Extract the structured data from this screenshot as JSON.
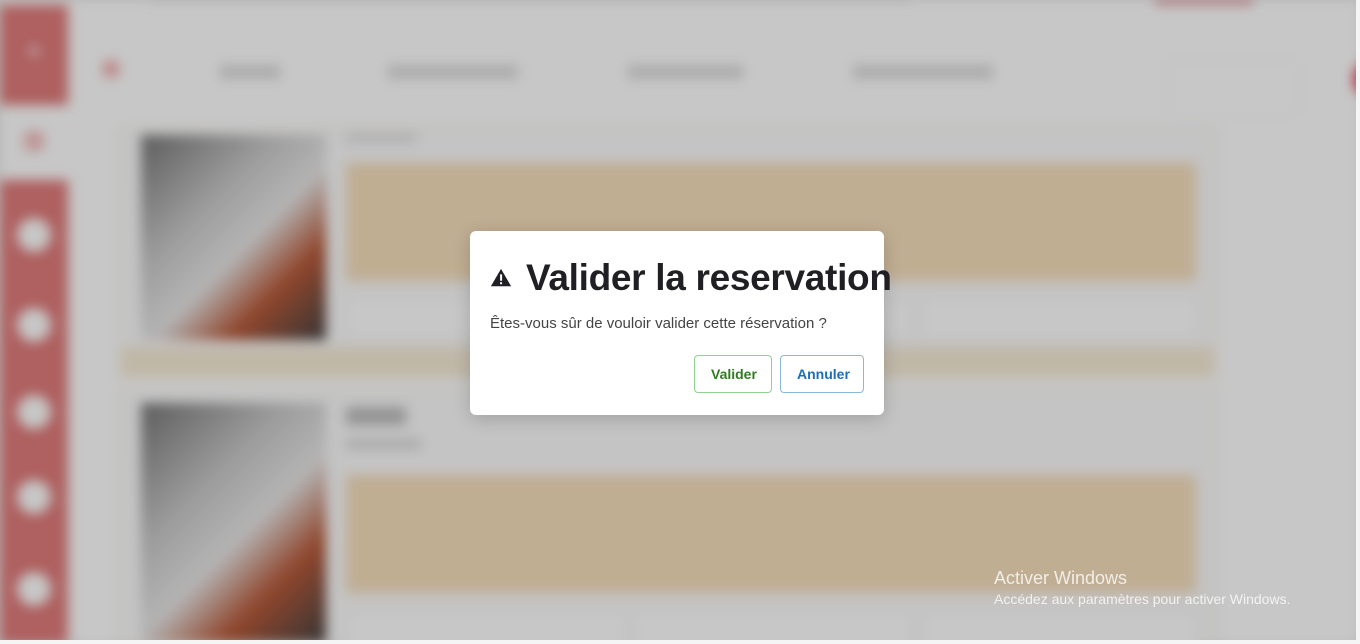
{
  "modal": {
    "title": "Valider la reservation",
    "message": "Êtes-vous sûr de vouloir valider cette réservation ?",
    "confirm_label": "Valider",
    "cancel_label": "Annuler",
    "icon": "warning-icon"
  },
  "watermark": {
    "title": "Activer Windows",
    "subtitle": "Accédez aux paramètres pour activer Windows."
  },
  "colors": {
    "sidebar": "#e07b7b",
    "card_info": "#f6dfbd",
    "confirm": "#2e7d1e",
    "cancel": "#1d6fb5"
  }
}
